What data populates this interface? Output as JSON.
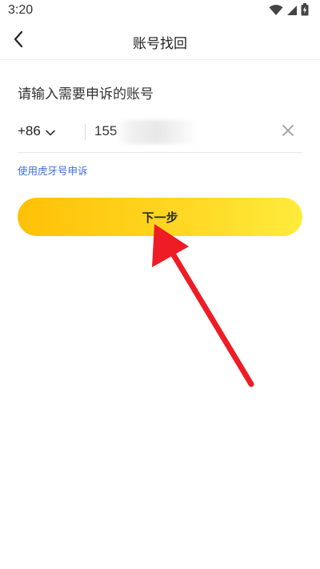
{
  "status_bar": {
    "time": "3:20"
  },
  "header": {
    "title": "账号找回",
    "back_icon": "chevron-left-icon"
  },
  "form": {
    "prompt": "请输入需要申诉的账号",
    "country_code": "+86",
    "phone_value": "155",
    "appeal_link": "使用虎牙号申诉",
    "next_label": "下一步"
  },
  "colors": {
    "accent_start": "#ffc107",
    "accent_end": "#ffeb3b",
    "link": "#3a6fd8",
    "annotation_arrow": "#ee1c25"
  }
}
